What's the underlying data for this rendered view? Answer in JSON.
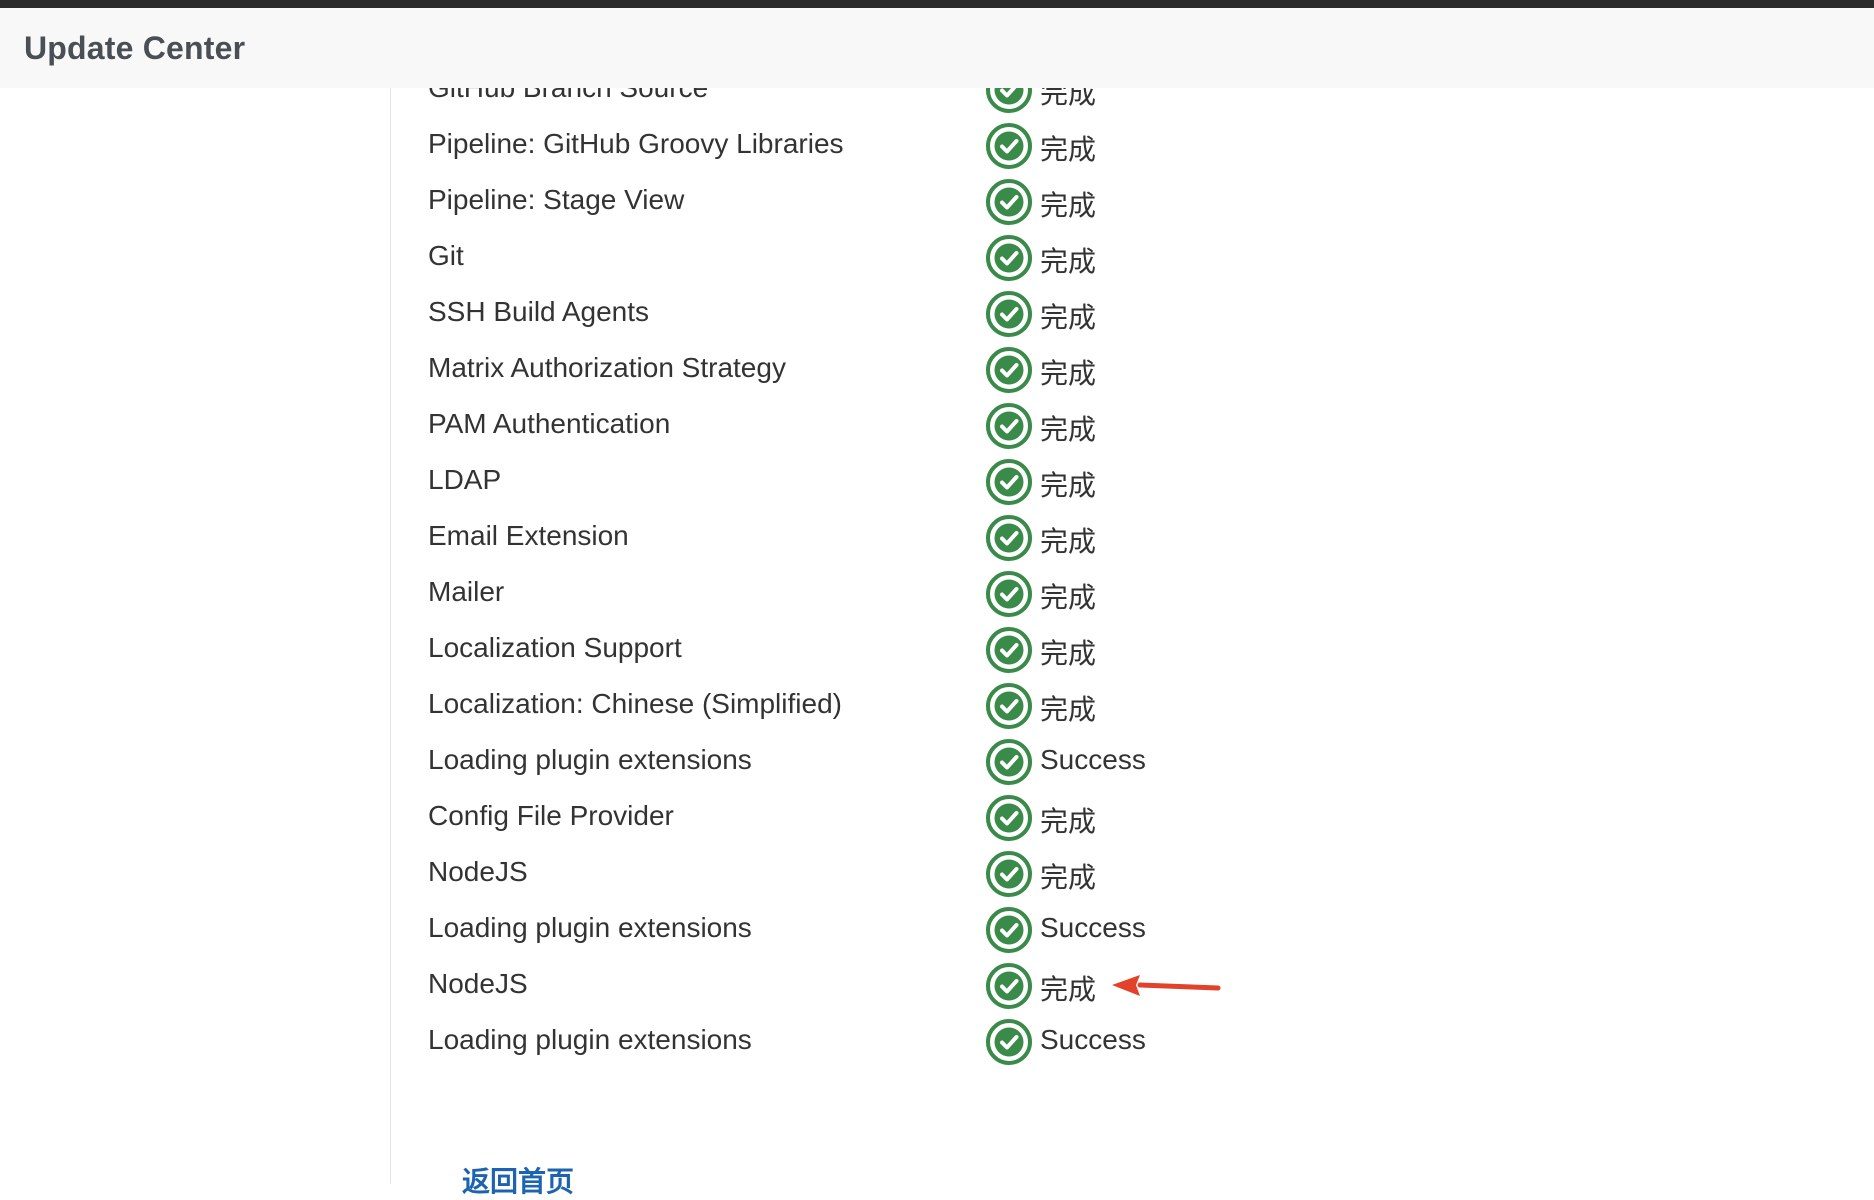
{
  "header": {
    "title": "Update Center"
  },
  "accent": {
    "success_green": "#3a8a4a",
    "arrow_red": "#e2412a",
    "link_blue": "#1d64b0"
  },
  "status_icon": "check-circle-icon",
  "plugins": [
    {
      "name": "GitHub Branch Source",
      "status": "完成"
    },
    {
      "name": "Pipeline: GitHub Groovy Libraries",
      "status": "完成"
    },
    {
      "name": "Pipeline: Stage View",
      "status": "完成"
    },
    {
      "name": "Git",
      "status": "完成"
    },
    {
      "name": "SSH Build Agents",
      "status": "完成"
    },
    {
      "name": "Matrix Authorization Strategy",
      "status": "完成"
    },
    {
      "name": "PAM Authentication",
      "status": "完成"
    },
    {
      "name": "LDAP",
      "status": "完成"
    },
    {
      "name": "Email Extension",
      "status": "完成"
    },
    {
      "name": "Mailer",
      "status": "完成"
    },
    {
      "name": "Localization Support",
      "status": "完成"
    },
    {
      "name": "Localization: Chinese (Simplified)",
      "status": "完成"
    },
    {
      "name": "Loading plugin extensions",
      "status": "Success"
    },
    {
      "name": "Config File Provider",
      "status": "完成"
    },
    {
      "name": "NodeJS",
      "status": "完成"
    },
    {
      "name": "Loading plugin extensions",
      "status": "Success"
    },
    {
      "name": "NodeJS",
      "status": "完成"
    },
    {
      "name": "Loading plugin extensions",
      "status": "Success"
    }
  ],
  "footer": {
    "home_link": "返回首页"
  }
}
